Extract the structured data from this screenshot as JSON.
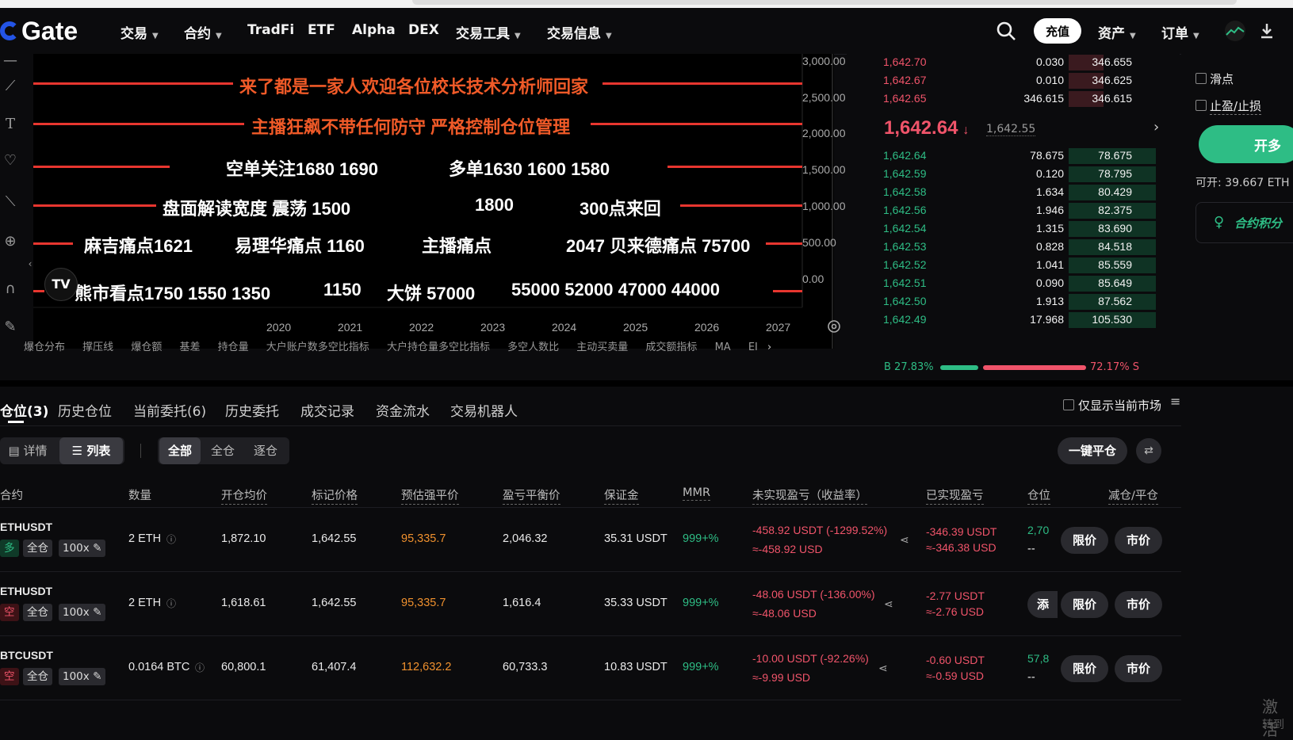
{
  "nav": {
    "logo": "Gate",
    "items": [
      {
        "label": "交易",
        "caret": true
      },
      {
        "label": "合约",
        "caret": true
      },
      {
        "label": "TradFi",
        "caret": false
      },
      {
        "label": "ETF",
        "caret": false
      },
      {
        "label": "Alpha",
        "caret": false
      },
      {
        "label": "DEX",
        "caret": false
      },
      {
        "label": "交易工具",
        "caret": true
      },
      {
        "label": "交易信息",
        "caret": true
      }
    ],
    "deposit": "充值",
    "assets": "资产",
    "orders": "订单"
  },
  "chart": {
    "yticks": [
      "3,000.00",
      "2,500.00",
      "2,000.00",
      "1,500.00",
      "1,000.00",
      "500.00",
      "0.00"
    ],
    "xticks": [
      "2020",
      "2021",
      "2022",
      "2023",
      "2024",
      "2025",
      "2026",
      "2027"
    ],
    "annotations": [
      "来了都是一家人欢迎各位校长技术分析师回家",
      "主播狂飙不带任何防守  严格控制仓位管理",
      "空单关注1680   1690",
      "多单1630   1600   1580",
      "盘面解读宽度  震荡 1500",
      "1800",
      "300点来回",
      "麻吉痛点1621",
      "易理华痛点 1160",
      "主播痛点",
      "2047 贝来德痛点 75700",
      "熊市看点1750     1550    1350",
      "1150",
      "大饼  57000",
      "55000    52000    47000    44000"
    ],
    "tv_logo": "TV",
    "indicator_tabs": [
      "爆仓分布",
      "撑压线",
      "爆仓额",
      "基差",
      "持仓量",
      "大户账户数多空比指标",
      "大户持仓量多空比指标",
      "多空人数比",
      "主动买卖量",
      "成交额指标",
      "MA",
      "EI"
    ]
  },
  "orderbook": {
    "asks": [
      {
        "price": "1,642.70",
        "amount": "0.030",
        "total": "346.655"
      },
      {
        "price": "1,642.67",
        "amount": "0.010",
        "total": "346.625"
      },
      {
        "price": "1,642.65",
        "amount": "346.615",
        "total": "346.615"
      }
    ],
    "last_price": "1,642.64",
    "mark_price": "1,642.55",
    "bids": [
      {
        "price": "1,642.64",
        "amount": "78.675",
        "total": "78.675"
      },
      {
        "price": "1,642.59",
        "amount": "0.120",
        "total": "78.795"
      },
      {
        "price": "1,642.58",
        "amount": "1.634",
        "total": "80.429"
      },
      {
        "price": "1,642.56",
        "amount": "1.946",
        "total": "82.375"
      },
      {
        "price": "1,642.54",
        "amount": "1.315",
        "total": "83.690"
      },
      {
        "price": "1,642.53",
        "amount": "0.828",
        "total": "84.518"
      },
      {
        "price": "1,642.52",
        "amount": "1.041",
        "total": "85.559"
      },
      {
        "price": "1,642.51",
        "amount": "0.090",
        "total": "85.649"
      },
      {
        "price": "1,642.50",
        "amount": "1.913",
        "total": "87.562"
      },
      {
        "price": "1,642.49",
        "amount": "17.968",
        "total": "105.530"
      }
    ],
    "ratio_b": "B 27.83%",
    "ratio_s": "72.17% S",
    "ratio_b_fraction": 0.2783
  },
  "right_panel": {
    "slippage": "滑点",
    "tpsl": "止盈/止损",
    "open_long": "开多",
    "available": "可开: 39.667 ETH",
    "promo": "合约积分"
  },
  "positions": {
    "tabs": [
      "仓位(3)",
      "历史仓位",
      "当前委托(6)",
      "历史委托",
      "成交记录",
      "资金流水",
      "交易机器人"
    ],
    "only_current": "仅显示当前市场",
    "view_detail": "详情",
    "view_list": "列表",
    "filters": [
      "全部",
      "全仓",
      "逐仓"
    ],
    "close_all": "一键平仓",
    "columns": [
      "合约",
      "数量",
      "开仓均价",
      "标记价格",
      "预估强平价",
      "盈亏平衡价",
      "保证金",
      "MMR",
      "未实现盈亏（收益率）",
      "已实现盈亏",
      "仓位",
      "减仓/平仓"
    ],
    "rows": [
      {
        "symbol": "ETHUSDT",
        "dir": "多",
        "mode": "全仓",
        "lev": "100x",
        "qty": "2 ETH",
        "entry": "1,872.10",
        "mark": "1,642.55",
        "liq": "95,335.7",
        "breakeven": "2,046.32",
        "margin": "35.31 USDT",
        "mmr": "999+%",
        "upnl": "-458.92 USDT (-1299.52%)",
        "upnl_usd": "≈-458.92 USD",
        "rpnl": "-346.39 USDT",
        "rpnl_usd": "≈-346.38 USD",
        "pos": "2,70",
        "pos2": "--",
        "limit": "限价",
        "market": "市价",
        "extra": ""
      },
      {
        "symbol": "ETHUSDT",
        "dir": "空",
        "mode": "全仓",
        "lev": "100x",
        "qty": "2 ETH",
        "entry": "1,618.61",
        "mark": "1,642.55",
        "liq": "95,335.7",
        "breakeven": "1,616.4",
        "margin": "35.33 USDT",
        "mmr": "999+%",
        "upnl": "-48.06 USDT (-136.00%)",
        "upnl_usd": "≈-48.06 USD",
        "rpnl": "-2.77 USDT",
        "rpnl_usd": "≈-2.76 USD",
        "pos": "",
        "pos2": "",
        "limit": "限价",
        "market": "市价",
        "extra": "添"
      },
      {
        "symbol": "BTCUSDT",
        "dir": "空",
        "mode": "全仓",
        "lev": "100x",
        "qty": "0.0164 BTC",
        "entry": "60,800.1",
        "mark": "61,407.4",
        "liq": "112,632.2",
        "breakeven": "60,733.3",
        "margin": "10.83 USDT",
        "mmr": "999+%",
        "upnl": "-10.00 USDT (-92.26%)",
        "upnl_usd": "≈-9.99 USD",
        "rpnl": "-0.60 USDT",
        "rpnl_usd": "≈-0.59 USD",
        "pos": "57,8",
        "pos2": "--",
        "limit": "限价",
        "market": "市价",
        "extra": ""
      }
    ]
  },
  "watermark": "激活",
  "watermark2": "转到"
}
